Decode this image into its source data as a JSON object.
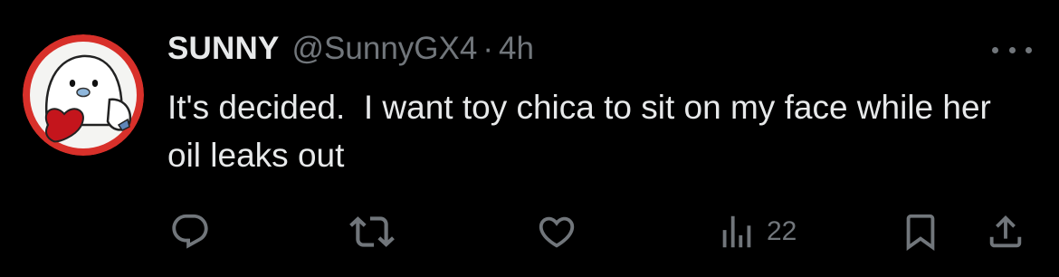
{
  "post": {
    "display_name": "SUNNY",
    "handle": "@SunnyGX4",
    "separator": "·",
    "time": "4h",
    "text": "It's decided.  I want toy chica to sit on my face while her oil leaks out"
  },
  "actions": {
    "reply": {
      "icon": "reply-icon"
    },
    "repost": {
      "icon": "repost-icon"
    },
    "like": {
      "icon": "heart-icon"
    },
    "views": {
      "icon": "views-icon",
      "count": "22"
    },
    "bookmark": {
      "icon": "bookmark-icon"
    },
    "share": {
      "icon": "share-icon"
    }
  },
  "colors": {
    "background": "#000000",
    "primary_text": "#e7e9ea",
    "secondary_text": "#71767b",
    "avatar_ring": "#d8302a",
    "avatar_heart": "#c4151c"
  }
}
